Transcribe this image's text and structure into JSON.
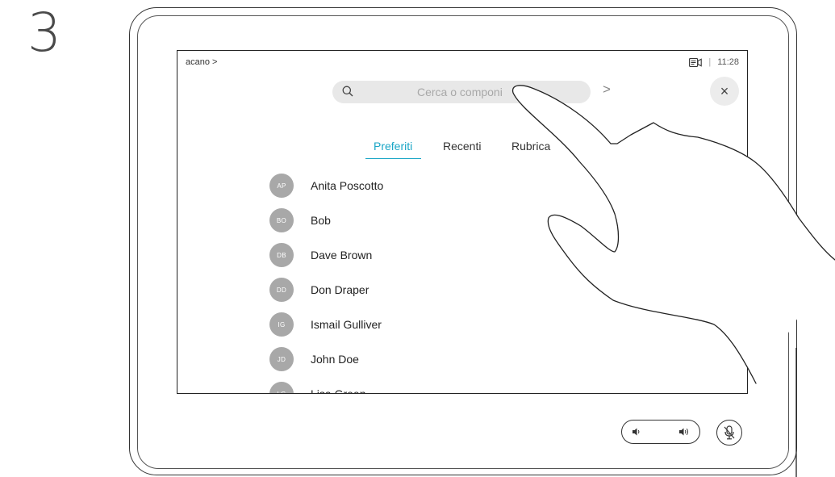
{
  "step": "3",
  "screen": {
    "breadcrumb": "acano >",
    "status": {
      "camera_icon": "camera-share-icon",
      "separator": "|",
      "time": "11:28"
    },
    "search": {
      "placeholder": "Cerca o componi",
      "icon": "search-icon"
    },
    "chevron": ">",
    "close": "×",
    "tabs": [
      {
        "label": "Preferiti",
        "active": true
      },
      {
        "label": "Recenti",
        "active": false
      },
      {
        "label": "Rubrica",
        "active": false
      }
    ],
    "contacts": [
      {
        "initials": "AP",
        "name": "Anita Poscotto"
      },
      {
        "initials": "BO",
        "name": "Bob"
      },
      {
        "initials": "DB",
        "name": "Dave Brown"
      },
      {
        "initials": "DD",
        "name": "Don Draper"
      },
      {
        "initials": "IG",
        "name": "Ismail Gulliver"
      },
      {
        "initials": "JD",
        "name": "John Doe"
      },
      {
        "initials": "LG",
        "name": "Lisa Green"
      }
    ]
  },
  "controls": {
    "volume_icons": [
      "volume-down-icon",
      "volume-up-icon"
    ],
    "mute_icon": "microphone-muted-icon"
  },
  "colors": {
    "accent": "#1aa6c6",
    "avatar": "#a8a8a8",
    "search_bg": "#e8e8e8"
  }
}
